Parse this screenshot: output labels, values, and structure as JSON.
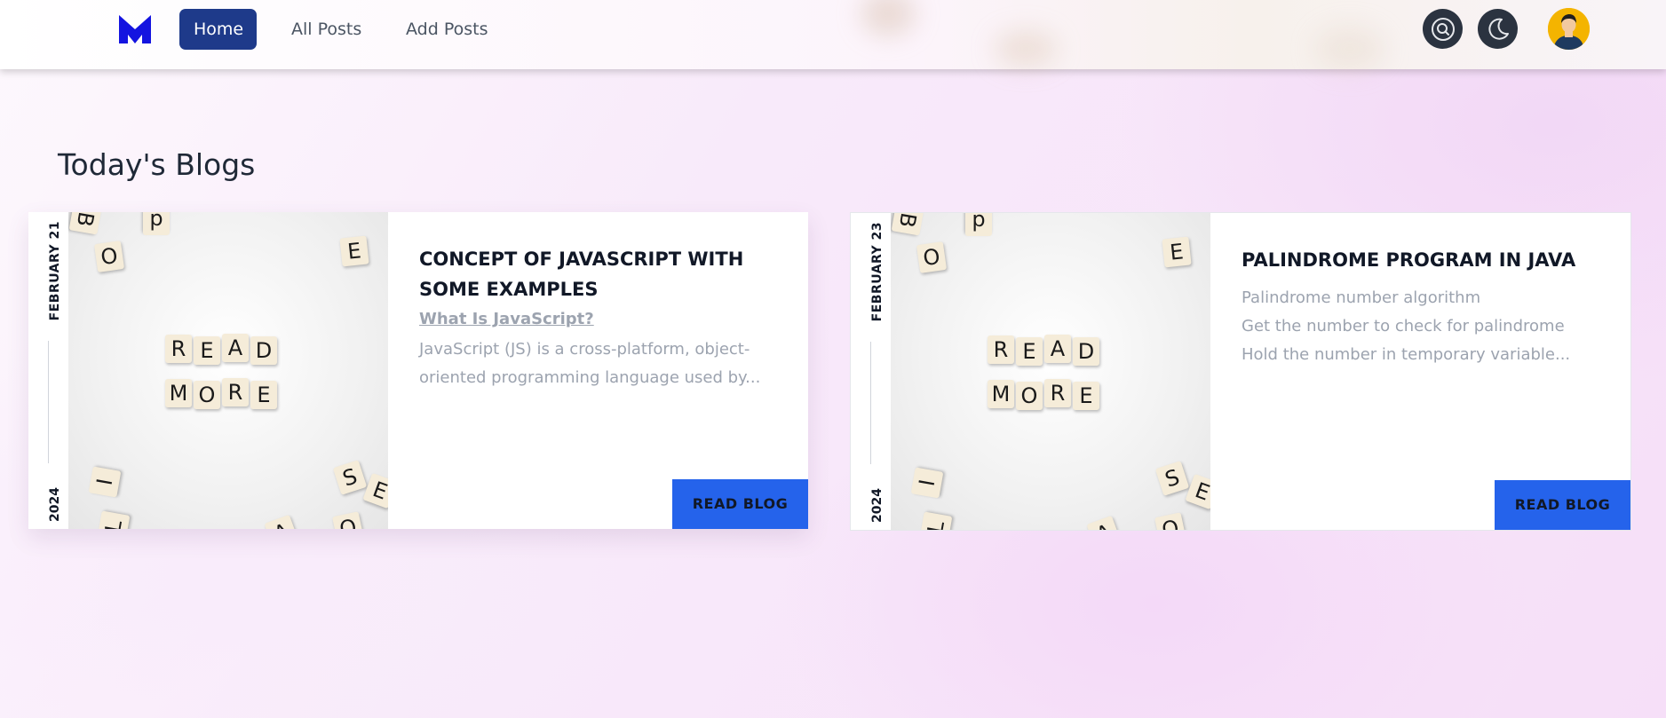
{
  "nav": {
    "links": [
      {
        "label": "Home",
        "active": true
      },
      {
        "label": "All Posts"
      },
      {
        "label": "Add Posts"
      }
    ],
    "icons": [
      "logo-m-icon",
      "search-icon",
      "moon-icon",
      "user-avatar"
    ]
  },
  "page": {
    "title": "Today's Blogs"
  },
  "cards": [
    {
      "month_day": "FEBRUARY 21",
      "year": "2024",
      "title": "CONCEPT OF JAVASCRIPT WITH SOME EXAMPLES",
      "subtitle": "What Is JavaScript?",
      "excerpt_lines": [
        "JavaScript (JS) is a cross-platform, object-",
        "oriented programming language used by..."
      ],
      "image_words": [
        "READ",
        "MORE"
      ],
      "button": "READ BLOG"
    },
    {
      "month_day": "FEBRUARY 23",
      "year": "2024",
      "title": "PALINDROME PROGRAM IN JAVA",
      "excerpt_lines": [
        "Palindrome number algorithm",
        "Get the number to check for palindrome",
        "Hold the number in temporary variable..."
      ],
      "image_words": [
        "READ",
        "MORE"
      ],
      "button": "READ BLOG"
    }
  ],
  "colors": {
    "primary": "#1e3a8a",
    "button": "#2563eb",
    "icon_bg": "#2b3340"
  }
}
